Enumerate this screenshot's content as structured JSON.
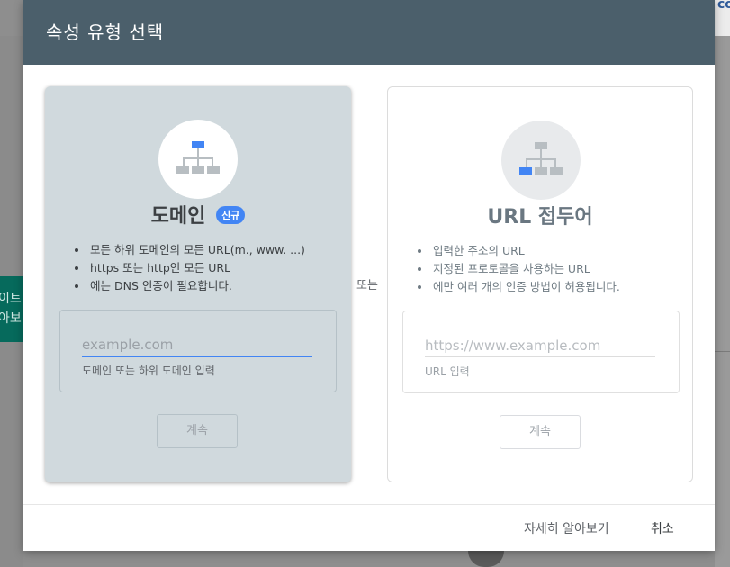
{
  "background": {
    "top_right_text": "co",
    "left_tab_lines": [
      "이트",
      "아보"
    ]
  },
  "dialog": {
    "title": "속성 유형 선택",
    "or_label": "또는",
    "learn_more_label": "자세히 알아보기",
    "cancel_label": "취소"
  },
  "domain_card": {
    "icon": "sitemap-icon",
    "title": "도메인",
    "badge": "신규",
    "bullets": [
      "모든 하위 도메인의 모든 URL(m., www. ...)",
      "https 또는 http인 모든 URL",
      "에는 DNS 인증이 필요합니다."
    ],
    "input_placeholder": "example.com",
    "input_value": "",
    "input_help": "도메인 또는 하위 도메인 입력",
    "continue_label": "계속"
  },
  "url_card": {
    "icon": "sitemap-icon",
    "title": "URL 접두어",
    "bullets": [
      "입력한 주소의 URL",
      "지정된 프로토콜을 사용하는 URL",
      "에만 여러 개의 인증 방법이 허용됩니다."
    ],
    "input_placeholder": "https://www.example.com",
    "input_value": "",
    "input_help": "URL 입력",
    "continue_label": "계속"
  },
  "colors": {
    "header": "#4b5f6b",
    "accent": "#4285f4",
    "domain_card_bg": "#d0d9dd"
  }
}
